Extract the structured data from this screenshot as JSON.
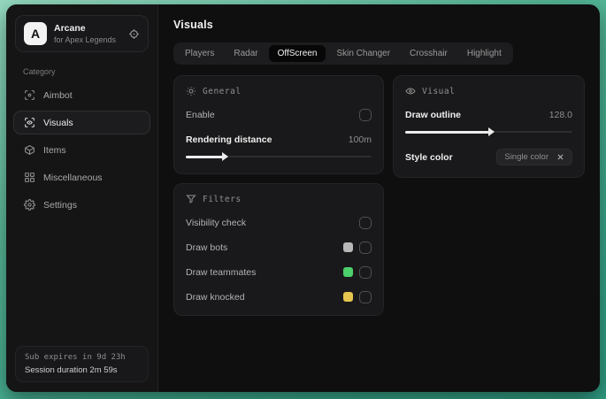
{
  "app": {
    "initial": "A",
    "name": "Arcane",
    "subtitle": "for Apex Legends"
  },
  "sidebar": {
    "category_label": "Category",
    "items": [
      {
        "label": "Aimbot",
        "icon": "crosshair-icon",
        "selected": false
      },
      {
        "label": "Visuals",
        "icon": "scan-eye-icon",
        "selected": true
      },
      {
        "label": "Items",
        "icon": "package-icon",
        "selected": false
      },
      {
        "label": "Miscellaneous",
        "icon": "grid-icon",
        "selected": false
      },
      {
        "label": "Settings",
        "icon": "gear-icon",
        "selected": false
      }
    ],
    "footer": {
      "sub_expires": "Sub expires in 9d 23h",
      "session_duration": "Session duration 2m 59s"
    }
  },
  "main": {
    "title": "Visuals",
    "tabs": [
      {
        "label": "Players",
        "selected": false
      },
      {
        "label": "Radar",
        "selected": false
      },
      {
        "label": "OffScreen",
        "selected": true
      },
      {
        "label": "Skin Changer",
        "selected": false
      },
      {
        "label": "Crosshair",
        "selected": false
      },
      {
        "label": "Highlight",
        "selected": false
      }
    ],
    "general": {
      "title": "General",
      "enable_label": "Enable",
      "enable_checked": false,
      "distance_label": "Rendering distance",
      "distance_value": "100m",
      "distance_fill_percent": 20
    },
    "filters": {
      "title": "Filters",
      "rows": [
        {
          "label": "Visibility check",
          "swatch": null,
          "checked": false
        },
        {
          "label": "Draw bots",
          "swatch": "#b8b8b8",
          "checked": false
        },
        {
          "label": "Draw teammates",
          "swatch": "#4cd06c",
          "checked": false
        },
        {
          "label": "Draw knocked",
          "swatch": "#e5c54e",
          "checked": false
        }
      ]
    },
    "visual": {
      "title": "Visual",
      "outline_label": "Draw outline",
      "outline_value": "128.0",
      "outline_fill_percent": 50,
      "style_label": "Style color",
      "style_value": "Single color"
    }
  },
  "colors": {
    "backdrop_teal": "#4ab292",
    "window_bg": "#0f0f10",
    "panel_bg": "#19191b",
    "accent_green_swatch": "#4cd06c",
    "accent_yellow_swatch": "#e5c54e",
    "accent_gray_swatch": "#b8b8b8"
  }
}
